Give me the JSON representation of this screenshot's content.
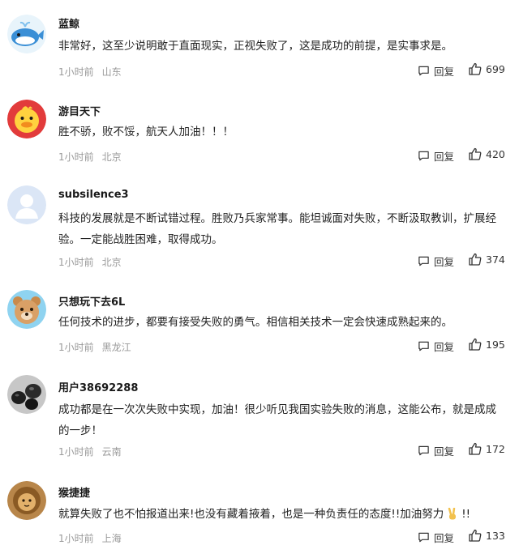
{
  "reply_label": "回复",
  "comments": [
    {
      "username": "蓝鲸",
      "text": "非常好，这至少说明敢于直面现实，正视失败了，这是成功的前提，是实事求是。",
      "time": "1小时前",
      "location": "山东",
      "likes": "699",
      "avatar": "blue-whale"
    },
    {
      "username": "游目天下",
      "text": "胜不骄，败不馁，航天人加油！！！",
      "time": "1小时前",
      "location": "北京",
      "likes": "420",
      "avatar": "yellow-duck"
    },
    {
      "username": "subsilence3",
      "text": "科技的发展就是不断试错过程。胜败乃兵家常事。能坦诚面对失败，不断汲取教训，扩展经验。一定能战胜困难，取得成功。",
      "time": "1小时前",
      "location": "北京",
      "likes": "374",
      "avatar": "default-user"
    },
    {
      "username": "只想玩下去6L",
      "text": "任何技术的进步，都要有接受失败的勇气。相信相关技术一定会快速成熟起来的。",
      "time": "1小时前",
      "location": "黑龙江",
      "likes": "195",
      "avatar": "cartoon-bear"
    },
    {
      "username": "用户38692288",
      "text": "成功都是在一次次失败中实现，加油！很少听见我国实验失败的消息，这能公布，就是成成的一步！",
      "time": "1小时前",
      "location": "云南",
      "likes": "172",
      "avatar": "black-stones"
    },
    {
      "username": "猴捷捷",
      "text": "就算失败了也不怕报道出来!也没有藏着掖着，也是一种负责任的态度!!加油努力",
      "text_suffix": "!!",
      "time": "1小时前",
      "location": "上海",
      "likes": "133",
      "avatar": "lion"
    }
  ]
}
